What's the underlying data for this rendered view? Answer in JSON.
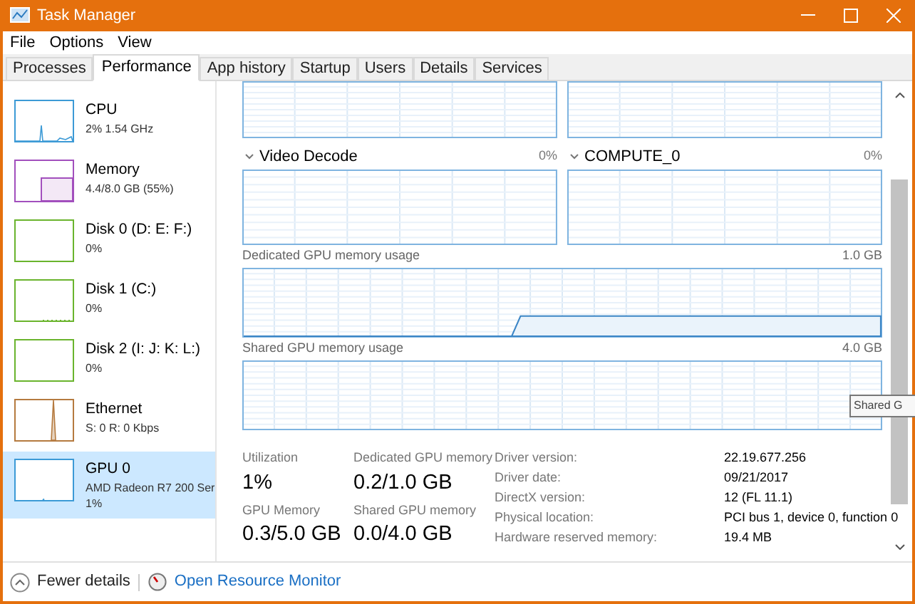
{
  "window": {
    "title": "Task Manager"
  },
  "menu": [
    "File",
    "Options",
    "View"
  ],
  "tabs": [
    {
      "label": "Processes",
      "selected": false
    },
    {
      "label": "Performance",
      "selected": true
    },
    {
      "label": "App history",
      "selected": false
    },
    {
      "label": "Startup",
      "selected": false
    },
    {
      "label": "Users",
      "selected": false
    },
    {
      "label": "Details",
      "selected": false
    },
    {
      "label": "Services",
      "selected": false
    }
  ],
  "sidebar": {
    "items": [
      {
        "kind": "cpu",
        "name": "CPU",
        "lines": [
          "2% 1.54 GHz"
        ],
        "color": "#3c9ad6",
        "selected": false
      },
      {
        "kind": "memory",
        "name": "Memory",
        "lines": [
          "4.4/8.0 GB (55%)"
        ],
        "color": "#a24fbd",
        "selected": false
      },
      {
        "kind": "disk",
        "name": "Disk 0 (D: E: F:)",
        "lines": [
          "0%"
        ],
        "color": "#6ab42d",
        "selected": false
      },
      {
        "kind": "disk",
        "name": "Disk 1 (C:)",
        "lines": [
          "0%"
        ],
        "color": "#6ab42d",
        "selected": false
      },
      {
        "kind": "disk",
        "name": "Disk 2 (I: J: K: L:)",
        "lines": [
          "0%"
        ],
        "color": "#6ab42d",
        "selected": false
      },
      {
        "kind": "network",
        "name": "Ethernet",
        "lines": [
          "S: 0 R: 0 Kbps"
        ],
        "color": "#b57a3f",
        "selected": false
      },
      {
        "kind": "gpu",
        "name": "GPU 0",
        "lines": [
          "AMD Radeon R7 200 Ser",
          "1%"
        ],
        "color": "#3c9ad6",
        "selected": true
      }
    ]
  },
  "engines": [
    {
      "name": "Video Decode",
      "value": "0%"
    },
    {
      "name": "COMPUTE_0",
      "value": "0%"
    }
  ],
  "memory_graphs": [
    {
      "label": "Dedicated GPU memory usage",
      "max": "1.0 GB"
    },
    {
      "label": "Shared GPU memory usage",
      "max": "4.0 GB"
    }
  ],
  "stats": [
    {
      "label": "Utilization",
      "value": "1%"
    },
    {
      "label": "Dedicated GPU memory",
      "value": "0.2/1.0 GB"
    },
    {
      "label": "GPU Memory",
      "value": "0.3/5.0 GB"
    },
    {
      "label": "Shared GPU memory",
      "value": "0.0/4.0 GB"
    }
  ],
  "details": [
    {
      "label": "Driver version:",
      "value": "22.19.677.256"
    },
    {
      "label": "Driver date:",
      "value": "09/21/2017"
    },
    {
      "label": "DirectX version:",
      "value": "12 (FL 11.1)"
    },
    {
      "label": "Physical location:",
      "value": "PCI bus 1, device 0, function 0"
    },
    {
      "label": "Hardware reserved memory:",
      "value": "19.4 MB"
    }
  ],
  "tooltip": "Shared G",
  "footer": {
    "fewer_details": "Fewer details",
    "resource_monitor": "Open Resource Monitor"
  }
}
